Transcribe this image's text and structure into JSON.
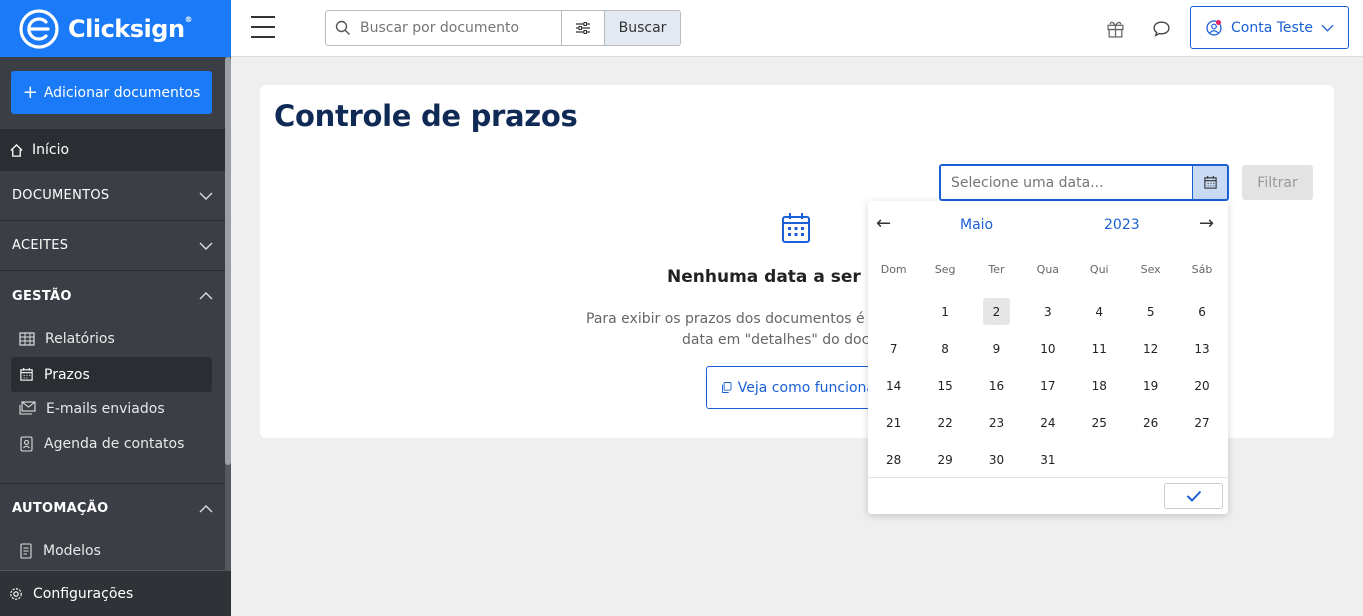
{
  "brand": {
    "name": "Clicksign",
    "reg_mark": "®"
  },
  "sidebar": {
    "add_button": "Adicionar documentos",
    "home": "Início",
    "sections": [
      {
        "label": "DOCUMENTOS"
      },
      {
        "label": "ACEITES"
      },
      {
        "label": "GESTÃO"
      },
      {
        "label": "AUTOMAÇÃO"
      }
    ],
    "gestao_items": [
      "Relatórios",
      "Prazos",
      "E-mails enviados",
      "Agenda de contatos"
    ],
    "automacao_items": [
      "Modelos"
    ],
    "settings": "Configurações"
  },
  "topbar": {
    "search_placeholder": "Buscar por documento",
    "search_button": "Buscar",
    "account": "Conta Teste"
  },
  "main": {
    "title": "Controle de prazos",
    "date_placeholder": "Selecione uma data...",
    "filter_button": "Filtrar",
    "empty_title": "Nenhuma data a ser e",
    "empty_desc_line1": "Para exibir os prazos dos documentos é pr",
    "empty_desc_line2": "data em \"detalhes\" do docu",
    "how_button": "Veja como funciona"
  },
  "datepicker": {
    "month": "Maio",
    "year": "2023",
    "weekdays": [
      "Dom",
      "Seg",
      "Ter",
      "Qua",
      "Qui",
      "Sex",
      "Sáb"
    ],
    "first_weekday_offset": 1,
    "days_in_month": 31,
    "highlighted_day": 2
  },
  "colors": {
    "brand_blue": "#1a7af8",
    "sidebar_bg": "#3b3f45",
    "title_navy": "#102a56",
    "link_blue": "#1a5fd6"
  }
}
